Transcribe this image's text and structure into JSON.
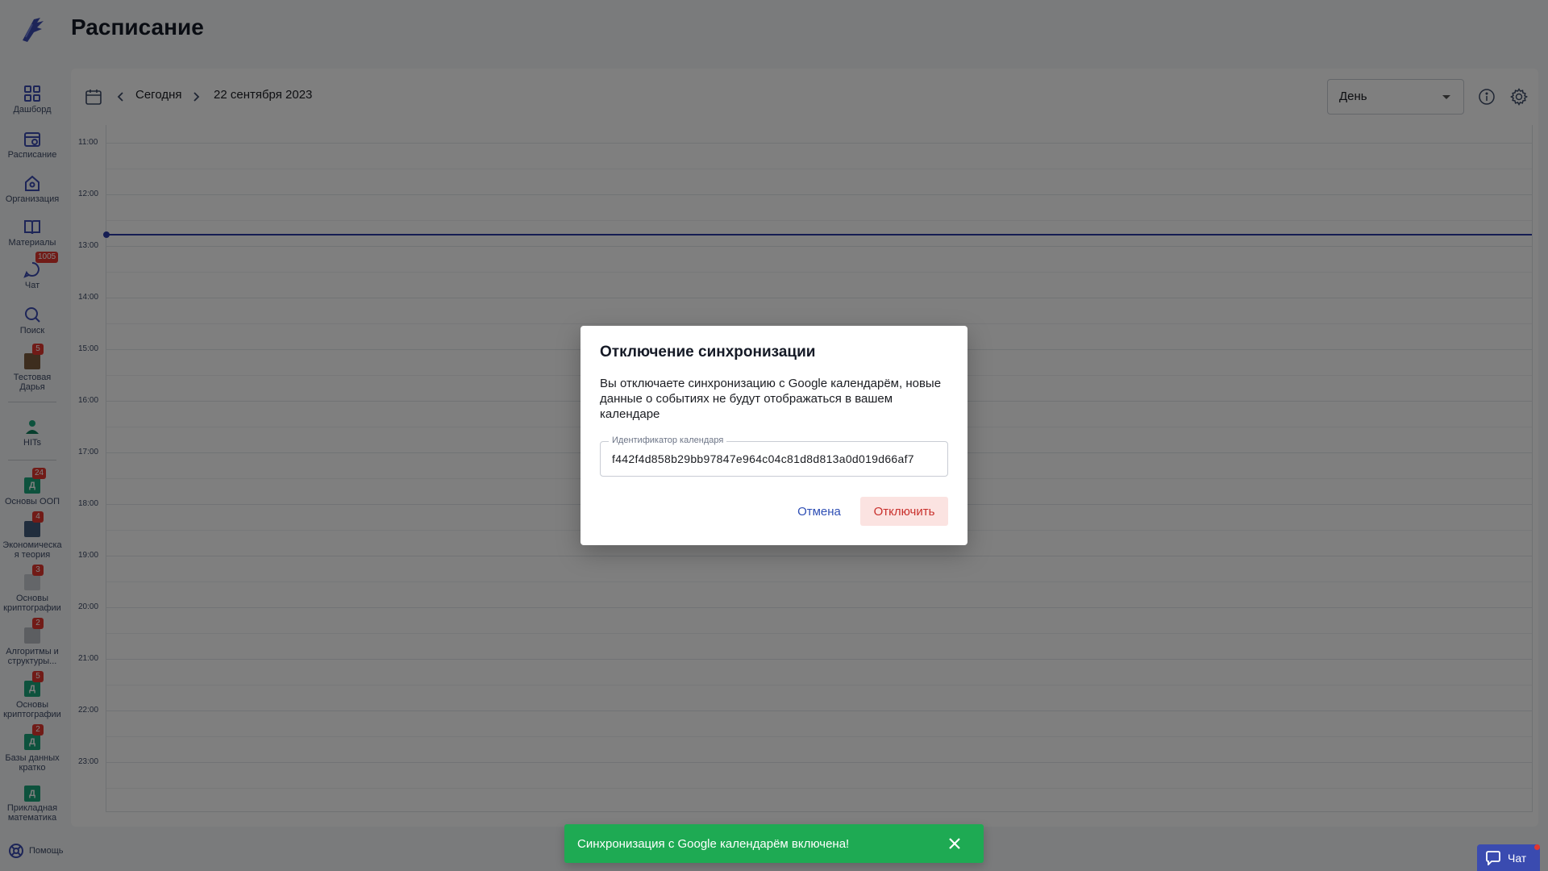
{
  "page": {
    "title": "Расписание"
  },
  "sidebar": {
    "items": [
      {
        "label": "Дашборд",
        "icon": "dashboard-icon"
      },
      {
        "label": "Расписание",
        "icon": "schedule-icon"
      },
      {
        "label": "Организация",
        "icon": "organization-icon"
      },
      {
        "label": "Материалы",
        "icon": "book-icon"
      },
      {
        "label": "Чат",
        "icon": "chat-icon",
        "badge": "1005"
      },
      {
        "label": "Поиск",
        "icon": "search-icon"
      },
      {
        "label": "Тестовая Дарья",
        "icon": "avatar-icon",
        "badge": "5"
      },
      {
        "label": "HITs",
        "icon": "hits-icon"
      },
      {
        "label": "Основы ООП",
        "icon": "course-icon",
        "badge": "24",
        "letter": "Д"
      },
      {
        "label": "Экономическая теория",
        "icon": "course-image-icon",
        "badge": "4"
      },
      {
        "label": "Основы криптографии",
        "icon": "course-image-icon",
        "badge": "3"
      },
      {
        "label": "Алгоритмы и структуры...",
        "icon": "course-image-icon",
        "badge": "2"
      },
      {
        "label": "Основы криптографии",
        "icon": "course-icon",
        "badge": "5",
        "letter": "Д"
      },
      {
        "label": "Базы данных кратко",
        "icon": "course-icon",
        "badge": "2",
        "letter": "Д"
      },
      {
        "label": "Прикладная математика",
        "icon": "course-icon",
        "letter": "Д"
      }
    ],
    "help_label": "Помощь"
  },
  "toolbar": {
    "today_label": "Сегодня",
    "date_label": "22 сентября 2023",
    "view_value": "День"
  },
  "calendar": {
    "hours": [
      "11:00",
      "12:00",
      "13:00",
      "14:00",
      "15:00",
      "16:00",
      "17:00",
      "18:00",
      "19:00",
      "20:00",
      "21:00",
      "22:00",
      "23:00"
    ],
    "current_time_line_color": "#2b3aa7"
  },
  "dialog": {
    "title": "Отключение синхронизации",
    "message": "Вы отключаете синхронизацию с Google календарём, новые данные о событиях не будут отображаться в вашем календаре",
    "field_label": "Идентификатор календаря",
    "field_value": "f442f4d858b29bb97847e964c04c81d8d813a0d019d66af7",
    "cancel_label": "Отмена",
    "confirm_label": "Отключить"
  },
  "toast": {
    "message": "Синхронизация с Google календарём включена!",
    "color": "#1eaa53"
  },
  "chat_button": {
    "label": "Чат"
  },
  "colors": {
    "accent": "#3a4bb0",
    "danger": "#e2362e"
  }
}
